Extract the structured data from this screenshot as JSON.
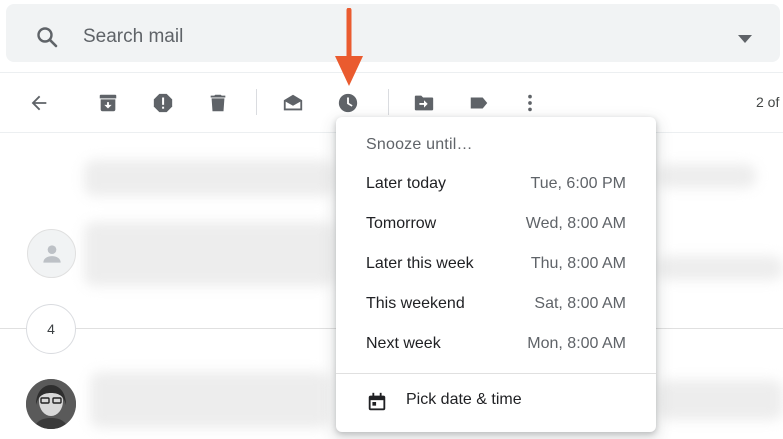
{
  "search": {
    "placeholder": "Search mail",
    "icon": "search-icon",
    "options_icon": "dropdown-caret-icon"
  },
  "toolbar": {
    "buttons": [
      {
        "name": "back",
        "icon": "arrow-back-icon"
      },
      {
        "name": "archive",
        "icon": "archive-icon"
      },
      {
        "name": "report-spam",
        "icon": "report-spam-icon"
      },
      {
        "name": "delete",
        "icon": "trash-icon"
      },
      {
        "name": "mark-unread",
        "icon": "mark-unread-icon"
      },
      {
        "name": "snooze",
        "icon": "clock-icon"
      },
      {
        "name": "move-to",
        "icon": "move-to-icon"
      },
      {
        "name": "labels",
        "icon": "label-icon"
      },
      {
        "name": "more",
        "icon": "more-vert-icon"
      }
    ],
    "pager": "2 of"
  },
  "thread": {
    "collapsed_count": "4"
  },
  "annotation": {
    "arrow_color": "#ea5b2f"
  },
  "snooze_menu": {
    "title": "Snooze until…",
    "items": [
      {
        "label": "Later today",
        "time": "Tue, 6:00 PM"
      },
      {
        "label": "Tomorrow",
        "time": "Wed, 8:00 AM"
      },
      {
        "label": "Later this week",
        "time": "Thu, 8:00 AM"
      },
      {
        "label": "This weekend",
        "time": "Sat, 8:00 AM"
      },
      {
        "label": "Next week",
        "time": "Mon, 8:00 AM"
      }
    ],
    "pick_label": "Pick date & time",
    "pick_icon": "calendar-icon"
  },
  "colors": {
    "search_bg": "#f1f3f4",
    "icon_gray": "#5f6368",
    "arrow": "#ea5b2f"
  }
}
